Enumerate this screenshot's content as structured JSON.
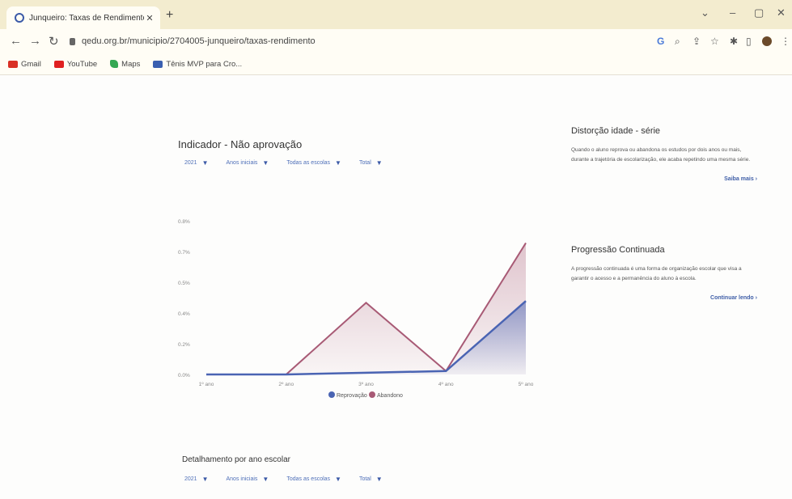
{
  "browser": {
    "tab_title": "Junqueiro: Taxas de Rendimento",
    "tab_close": "✕",
    "new_tab": "+",
    "url": "qedu.org.br/municipio/2704005-junqueiro/taxas-rendimento",
    "bookmarks": [
      {
        "label": "Gmail",
        "color": "#d93025"
      },
      {
        "label": "YouTube",
        "color": "#e02020"
      },
      {
        "label": "Maps",
        "color": "#34a853"
      },
      {
        "label": "Tênis MVP para Cro...",
        "color": "#3a5fb0"
      }
    ]
  },
  "indicator": {
    "title": "Indicador - Não aprovação",
    "filters": [
      "2021",
      "Anos iniciais",
      "Todas as escolas",
      "Total"
    ]
  },
  "chart_data": {
    "type": "line",
    "categories": [
      "1º ano",
      "2º ano",
      "3º ano",
      "4º ano",
      "5º ano"
    ],
    "y_ticks": [
      "0.0%",
      "0.2%",
      "0.4%",
      "0.5%",
      "0.7%",
      "0.8%"
    ],
    "ylim": [
      0,
      0.9
    ],
    "grid": false,
    "legend_position": "bottom",
    "series": [
      {
        "name": "Reprovação",
        "color": "#4a64b3",
        "values": [
          0,
          0,
          0.01,
          0.02,
          0.43
        ]
      },
      {
        "name": "Abandono",
        "color": "#a85a75",
        "values": [
          0,
          0,
          0.42,
          0.02,
          0.77
        ]
      }
    ]
  },
  "sidebar": {
    "card1": {
      "title": "Distorção idade - série",
      "text": "Quando o aluno reprova ou abandona os estudos por dois anos ou mais, durante a trajetória de escolarização, ele acaba repetindo uma mesma série.",
      "link": "Saiba mais"
    },
    "card2": {
      "title": "Progressão Continuada",
      "text": "A progressão continuada é uma forma de organização escolar que visa a garantir o acesso e a permanência do aluno à escola.",
      "link": "Continuar lendo"
    }
  },
  "detail": {
    "title": "Detalhamento por ano escolar",
    "filters": [
      "2021",
      "Anos iniciais",
      "Todas as escolas",
      "Total"
    ]
  }
}
